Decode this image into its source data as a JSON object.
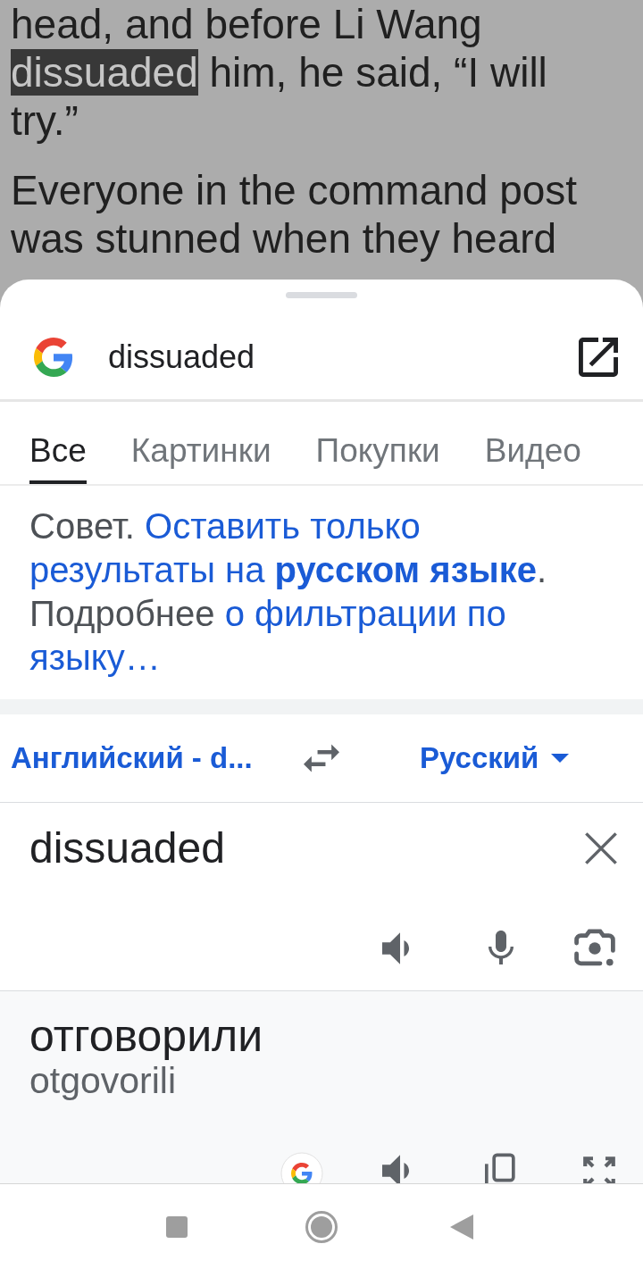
{
  "article": {
    "paragraphs": [
      {
        "segments": [
          {
            "text": "head, and before Li Wang",
            "selected": false
          },
          {
            "text": "dissuaded",
            "selected": true
          },
          {
            "text": "him, he said, “I will try.”",
            "selected": false
          }
        ]
      },
      {
        "segments": [
          {
            "text": "Everyone in the command post was stunned when they heard",
            "selected": false
          }
        ]
      }
    ]
  },
  "sheet": {
    "search": {
      "query": "dissuaded"
    },
    "tabs": [
      {
        "label": "Все",
        "selected": true
      },
      {
        "label": "Картинки",
        "selected": false
      },
      {
        "label": "Покупки",
        "selected": false
      },
      {
        "label": "Видео",
        "selected": false
      }
    ],
    "tip": {
      "lines": [
        [
          {
            "kind": "plain",
            "text": "Совет."
          },
          {
            "kind": "link",
            "text": "Оставить только"
          }
        ],
        [
          {
            "kind": "link",
            "text": "результаты на **русском языке**"
          },
          {
            "kind": "plain",
            "text": "."
          }
        ],
        [
          {
            "kind": "plain",
            "text": "Подробнее"
          },
          {
            "kind": "link",
            "text": "о фильтрации по"
          }
        ],
        [
          {
            "kind": "link",
            "text": "языку…"
          }
        ]
      ]
    },
    "translator": {
      "source_language": "Английский - d...",
      "target_language": "Русский",
      "input": {
        "value": "dissuaded"
      },
      "output": {
        "translation": "отговорили",
        "transliteration": "otgovorili"
      }
    }
  }
}
